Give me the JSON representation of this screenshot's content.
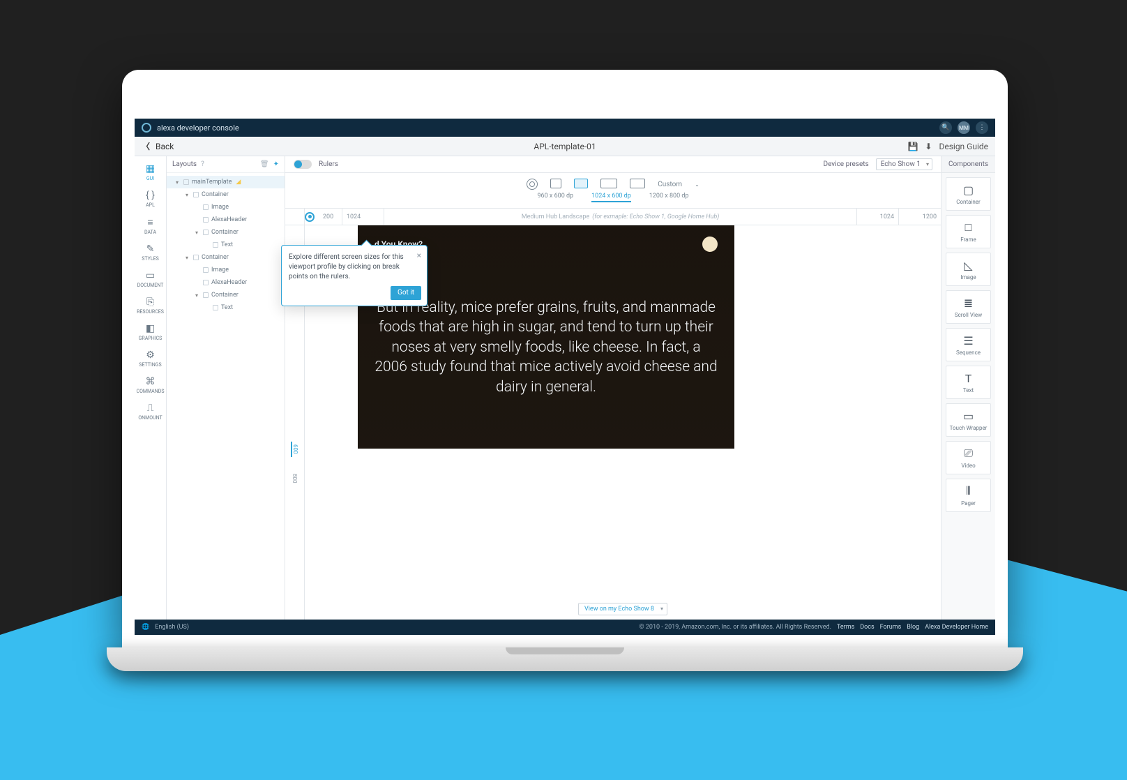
{
  "topbar": {
    "title": "alexa developer console",
    "avatar": "MM"
  },
  "subhead": {
    "back": "Back",
    "title": "APL-template-01",
    "guide": "Design Guide"
  },
  "rail": [
    {
      "label": "GUI",
      "icon": "▦"
    },
    {
      "label": "APL",
      "icon": "{ }"
    },
    {
      "label": "DATA",
      "icon": "≡"
    },
    {
      "label": "STYLES",
      "icon": "✎"
    },
    {
      "label": "DOCUMENT",
      "icon": "▭"
    },
    {
      "label": "RESOURCES",
      "icon": "⎘"
    },
    {
      "label": "GRAPHICS",
      "icon": "◧"
    },
    {
      "label": "SETTINGS",
      "icon": "⚙"
    },
    {
      "label": "COMMANDS",
      "icon": "⌘"
    },
    {
      "label": "ONMOUNT",
      "icon": "⎍"
    }
  ],
  "layouts": {
    "header": "Layouts",
    "tree": [
      {
        "depth": 1,
        "caret": true,
        "label": "mainTemplate",
        "hl": true
      },
      {
        "depth": 2,
        "caret": true,
        "label": "Container"
      },
      {
        "depth": 3,
        "caret": false,
        "label": "Image"
      },
      {
        "depth": 3,
        "caret": false,
        "label": "AlexaHeader"
      },
      {
        "depth": 3,
        "caret": true,
        "label": "Container"
      },
      {
        "depth": 4,
        "caret": false,
        "label": "Text"
      },
      {
        "depth": 2,
        "caret": true,
        "label": "Container"
      },
      {
        "depth": 3,
        "caret": false,
        "label": "Image"
      },
      {
        "depth": 3,
        "caret": false,
        "label": "AlexaHeader"
      },
      {
        "depth": 3,
        "caret": true,
        "label": "Container"
      },
      {
        "depth": 4,
        "caret": false,
        "label": "Text"
      }
    ]
  },
  "canvas": {
    "rulers_label": "Rulers",
    "device_presets_label": "Device presets",
    "device_preset_value": "Echo Show 1",
    "custom_label": "Custom",
    "sizes": [
      "960 x 600 dp",
      "1024 x 600 dp",
      "1200 x 800 dp"
    ],
    "active_size_index": 1,
    "ruler": {
      "left1": "200",
      "left2": "1024",
      "desc_prefix": "Medium Hub Landscape ",
      "desc_italic": "(for exmaple: Echo Show 1, Google Home Hub)",
      "right1": "1024",
      "right2": "1200"
    },
    "vruler": [
      "600",
      "800"
    ],
    "viewon": "View on my Echo Show 8"
  },
  "tooltip": {
    "text": "Explore different screen sizes for this viewport profile by clicking on break points on the rulers.",
    "cta": "Got it"
  },
  "preview": {
    "header": "d You Know?",
    "body": "But in reality, mice prefer grains, fruits, and manmade foods that are high in sugar, and tend to turn up their noses at very smelly foods, like cheese. In fact, a 2006 study found that mice actively avoid cheese and dairy in general."
  },
  "components": {
    "header": "Components",
    "items": [
      {
        "label": "Container",
        "icon": "▢"
      },
      {
        "label": "Frame",
        "icon": "□"
      },
      {
        "label": "Image",
        "icon": "◺"
      },
      {
        "label": "Scroll View",
        "icon": "≣"
      },
      {
        "label": "Sequence",
        "icon": "☰"
      },
      {
        "label": "Text",
        "icon": "T"
      },
      {
        "label": "Touch Wrapper",
        "icon": "▭"
      },
      {
        "label": "Video",
        "icon": "⎚"
      },
      {
        "label": "Pager",
        "icon": "⦀"
      }
    ]
  },
  "footer": {
    "lang": "English (US)",
    "copyright": "© 2010 - 2019, Amazon.com, Inc. or its affiliates. All Rights Reserved.",
    "links": [
      "Terms",
      "Docs",
      "Forums",
      "Blog",
      "Alexa Developer Home"
    ]
  }
}
